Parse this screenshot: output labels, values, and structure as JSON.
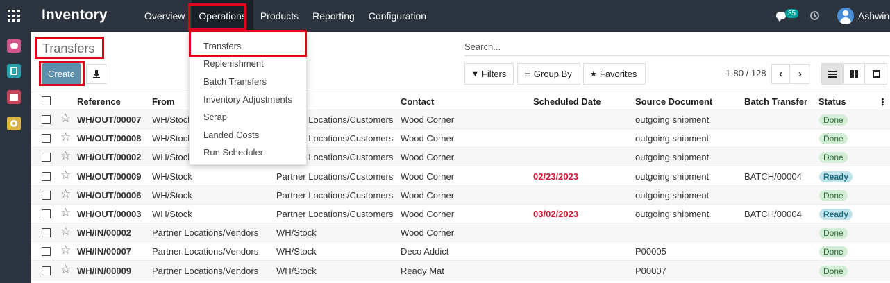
{
  "app": {
    "title": "Inventory"
  },
  "nav": {
    "items": [
      "Overview",
      "Operations",
      "Products",
      "Reporting",
      "Configuration"
    ],
    "active": "Operations"
  },
  "systray": {
    "message_count": "35",
    "user_name": "Ashwin"
  },
  "dropdown": {
    "items": [
      "Transfers",
      "Replenishment",
      "Batch Transfers",
      "Inventory Adjustments",
      "Scrap",
      "Landed Costs",
      "Run Scheduler"
    ]
  },
  "control_panel": {
    "breadcrumb": "Transfers",
    "create_label": "Create",
    "search_placeholder": "Search...",
    "filters_label": "Filters",
    "groupby_label": "Group By",
    "favorites_label": "Favorites",
    "pager_text": "1-80 / 128"
  },
  "table": {
    "columns": [
      "Reference",
      "From",
      "Contact",
      "Scheduled Date",
      "Source Document",
      "Batch Transfer",
      "Status"
    ],
    "rows": [
      {
        "ref": "WH/OUT/00007",
        "from": "WH/Stock",
        "to": "Partner Locations/Customers",
        "contact": "Wood Corner",
        "date": "",
        "source": "outgoing shipment",
        "batch": "",
        "status": "Done"
      },
      {
        "ref": "WH/OUT/00008",
        "from": "WH/Stock",
        "to": "Partner Locations/Customers",
        "contact": "Wood Corner",
        "date": "",
        "source": "outgoing shipment",
        "batch": "",
        "status": "Done"
      },
      {
        "ref": "WH/OUT/00002",
        "from": "WH/Stock",
        "to": "Partner Locations/Customers",
        "contact": "Wood Corner",
        "date": "",
        "source": "outgoing shipment",
        "batch": "",
        "status": "Done"
      },
      {
        "ref": "WH/OUT/00009",
        "from": "WH/Stock",
        "to": "Partner Locations/Customers",
        "contact": "Wood Corner",
        "date": "02/23/2023",
        "source": "outgoing shipment",
        "batch": "BATCH/00004",
        "status": "Ready"
      },
      {
        "ref": "WH/OUT/00006",
        "from": "WH/Stock",
        "to": "Partner Locations/Customers",
        "contact": "Wood Corner",
        "date": "",
        "source": "outgoing shipment",
        "batch": "",
        "status": "Done"
      },
      {
        "ref": "WH/OUT/00003",
        "from": "WH/Stock",
        "to": "Partner Locations/Customers",
        "contact": "Wood Corner",
        "date": "03/02/2023",
        "source": "outgoing shipment",
        "batch": "BATCH/00004",
        "status": "Ready"
      },
      {
        "ref": "WH/IN/00002",
        "from": "Partner Locations/Vendors",
        "to": "WH/Stock",
        "contact": "Wood Corner",
        "date": "",
        "source": "",
        "batch": "",
        "status": "Done"
      },
      {
        "ref": "WH/IN/00007",
        "from": "Partner Locations/Vendors",
        "to": "WH/Stock",
        "contact": "Deco Addict",
        "date": "",
        "source": "P00005",
        "batch": "",
        "status": "Done"
      },
      {
        "ref": "WH/IN/00009",
        "from": "Partner Locations/Vendors",
        "to": "WH/Stock",
        "contact": "Ready Mat",
        "date": "",
        "source": "P00007",
        "batch": "",
        "status": "Done"
      }
    ]
  },
  "colors": {
    "navbar": "#2c3440",
    "create_button": "#5c8fac",
    "annotation": "#e0001a",
    "late_date": "#d01834",
    "status_done": "#d2ecd5",
    "status_ready": "#bfe3ea"
  }
}
